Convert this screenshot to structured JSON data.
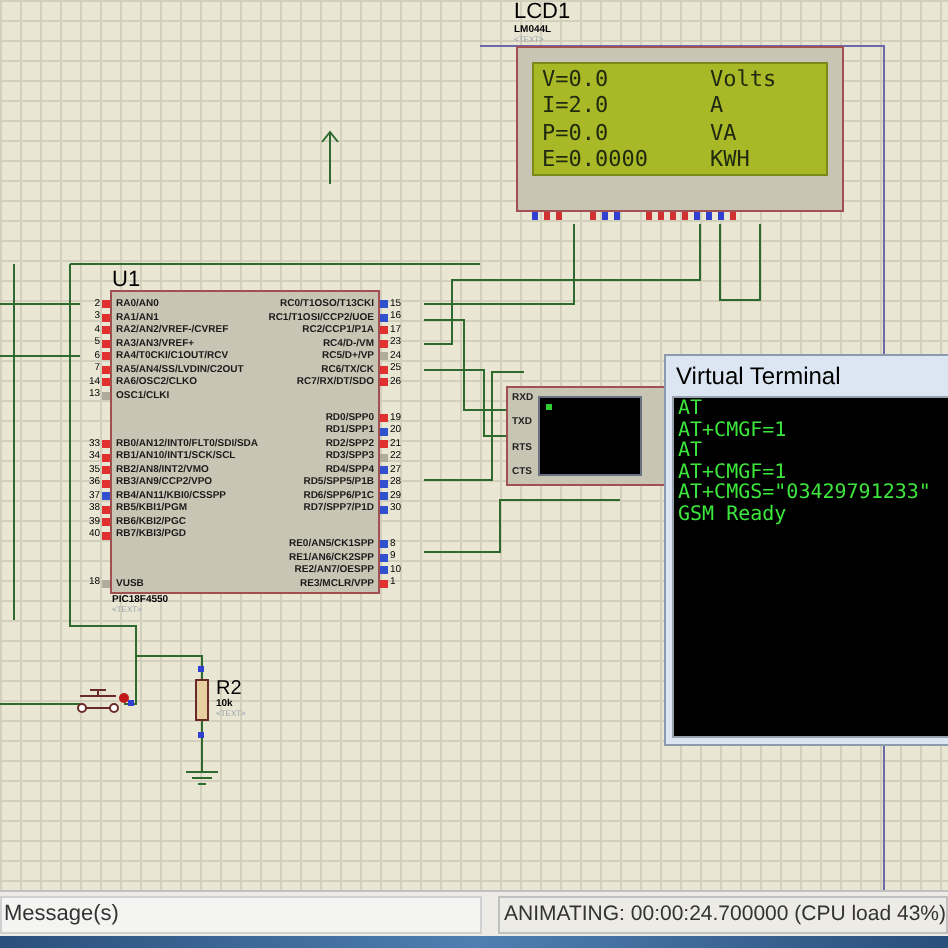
{
  "lcd": {
    "ref": "LCD1",
    "part": "LM044L",
    "text_tag": "<TEXT>",
    "rows": [
      {
        "reading": "V=0.0",
        "unit": "Volts"
      },
      {
        "reading": "I=2.0",
        "unit": "A"
      },
      {
        "reading": "P=0.0",
        "unit": "VA"
      },
      {
        "reading": "E=0.0000",
        "unit": "KWH"
      }
    ]
  },
  "mcu": {
    "ref": "U1",
    "part": "PIC18F4550",
    "text_tag": "<TEXT>",
    "left_pin_groups": [
      [
        {
          "number": "2",
          "name": "RA0/AN0",
          "color": "#e03030"
        },
        {
          "number": "3",
          "name": "RA1/AN1",
          "color": "#e03030"
        },
        {
          "number": "4",
          "name": "RA2/AN2/VREF-/CVREF",
          "color": "#e03030"
        },
        {
          "number": "5",
          "name": "RA3/AN3/VREF+",
          "color": "#e03030"
        },
        {
          "number": "6",
          "name": "RA4/T0CKI/C1OUT/RCV",
          "color": "#e03030"
        },
        {
          "number": "7",
          "name": "RA5/AN4/SS/LVDIN/C2OUT",
          "color": "#e03030"
        },
        {
          "number": "14",
          "name": "RA6/OSC2/CLKO",
          "color": "#e03030"
        },
        {
          "number": "13",
          "name": "OSC1/CLKI",
          "color": "#b0ac9c"
        }
      ],
      [
        {
          "number": "33",
          "name": "RB0/AN12/INT0/FLT0/SDI/SDA",
          "color": "#e03030"
        },
        {
          "number": "34",
          "name": "RB1/AN10/INT1/SCK/SCL",
          "color": "#e03030"
        },
        {
          "number": "35",
          "name": "RB2/AN8/INT2/VMO",
          "color": "#e03030"
        },
        {
          "number": "36",
          "name": "RB3/AN9/CCP2/VPO",
          "color": "#e03030"
        },
        {
          "number": "37",
          "name": "RB4/AN11/KBI0/CSSPP",
          "color": "#3050d0"
        },
        {
          "number": "38",
          "name": "RB5/KBI1/PGM",
          "color": "#e03030"
        },
        {
          "number": "39",
          "name": "RB6/KBI2/PGC",
          "color": "#e03030"
        },
        {
          "number": "40",
          "name": "RB7/KBI3/PGD",
          "color": "#e03030"
        }
      ],
      [
        {
          "number": "18",
          "name": "VUSB",
          "color": "#b0ac9c"
        }
      ]
    ],
    "right_pin_groups": [
      [
        {
          "number": "15",
          "name": "RC0/T1OSO/T13CKI",
          "color": "#3050d0"
        },
        {
          "number": "16",
          "name": "RC1/T1OSI/CCP2/UOE",
          "color": "#3050d0"
        },
        {
          "number": "17",
          "name": "RC2/CCP1/P1A",
          "color": "#e03030"
        },
        {
          "number": "23",
          "name": "RC4/D-/VM",
          "color": "#e03030"
        },
        {
          "number": "24",
          "name": "RC5/D+/VP",
          "color": "#b0ac9c"
        },
        {
          "number": "25",
          "name": "RC6/TX/CK",
          "color": "#e03030"
        },
        {
          "number": "26",
          "name": "RC7/RX/DT/SDO",
          "color": "#e03030"
        }
      ],
      [
        {
          "number": "19",
          "name": "RD0/SPP0",
          "color": "#e03030"
        },
        {
          "number": "20",
          "name": "RD1/SPP1",
          "color": "#3050d0"
        },
        {
          "number": "21",
          "name": "RD2/SPP2",
          "color": "#e03030"
        },
        {
          "number": "22",
          "name": "RD3/SPP3",
          "color": "#b0ac9c"
        },
        {
          "number": "27",
          "name": "RD4/SPP4",
          "color": "#3050d0"
        },
        {
          "number": "28",
          "name": "RD5/SPP5/P1B",
          "color": "#3050d0"
        },
        {
          "number": "29",
          "name": "RD6/SPP6/P1C",
          "color": "#3050d0"
        },
        {
          "number": "30",
          "name": "RD7/SPP7/P1D",
          "color": "#3050d0"
        }
      ],
      [
        {
          "number": "8",
          "name": "RE0/AN5/CK1SPP",
          "color": "#3050d0"
        },
        {
          "number": "9",
          "name": "RE1/AN6/CK2SPP",
          "color": "#3050d0"
        },
        {
          "number": "10",
          "name": "RE2/AN7/OESPP",
          "color": "#3050d0"
        },
        {
          "number": "1",
          "name": "RE3/MCLR/VPP",
          "color": "#e03030"
        }
      ]
    ]
  },
  "serial_device": {
    "pins": [
      "RXD",
      "TXD",
      "RTS",
      "CTS"
    ]
  },
  "resistor": {
    "ref": "R2",
    "value": "10k",
    "text_tag": "<TEXT>"
  },
  "terminal_window": {
    "title": "Virtual Terminal",
    "lines": [
      "AT",
      "AT+CMGF=1",
      "AT",
      "AT+CMGF=1",
      "AT+CMGS=\"03429791233\"",
      "GSM Ready"
    ]
  },
  "status_bar": {
    "messages": "Message(s)",
    "animation": "ANIMATING: 00:00:24.700000 (CPU load 43%)"
  }
}
